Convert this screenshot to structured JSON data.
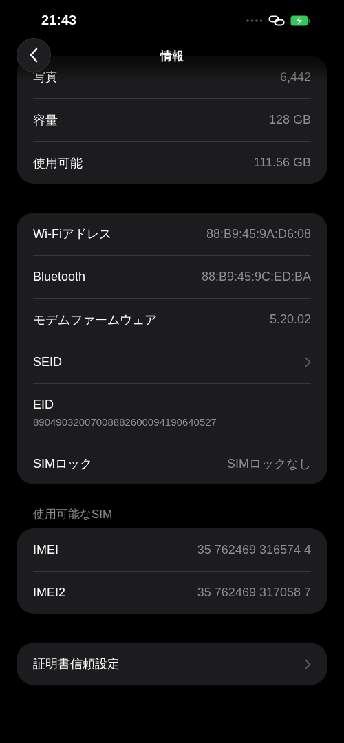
{
  "status_bar": {
    "time": "21:43"
  },
  "nav": {
    "title": "情報"
  },
  "sections": [
    {
      "rows": [
        {
          "kind": "value",
          "label": "写真",
          "value": "6,442"
        },
        {
          "kind": "value",
          "label": "容量",
          "value": "128 GB"
        },
        {
          "kind": "value",
          "label": "使用可能",
          "value": "111.56 GB"
        }
      ]
    },
    {
      "rows": [
        {
          "kind": "value",
          "label": "Wi-Fiアドレス",
          "value": "88:B9:45:9A:D6:08"
        },
        {
          "kind": "value",
          "label": "Bluetooth",
          "value": "88:B9:45:9C:ED:BA"
        },
        {
          "kind": "value",
          "label": "モデムファームウェア",
          "value": "5.20.02"
        },
        {
          "kind": "link",
          "label": "SEID"
        },
        {
          "kind": "stacked",
          "label": "EID",
          "value": "89049032007008882600094190640527"
        },
        {
          "kind": "value",
          "label": "SIMロック",
          "value": "SIMロックなし"
        }
      ]
    },
    {
      "header": "使用可能なSIM",
      "rows": [
        {
          "kind": "value",
          "label": "IMEI",
          "value": "35 762469 316574 4"
        },
        {
          "kind": "value",
          "label": "IMEI2",
          "value": "35 762469 317058 7"
        }
      ]
    },
    {
      "rows": [
        {
          "kind": "link",
          "label": "証明書信頼設定"
        }
      ]
    }
  ]
}
